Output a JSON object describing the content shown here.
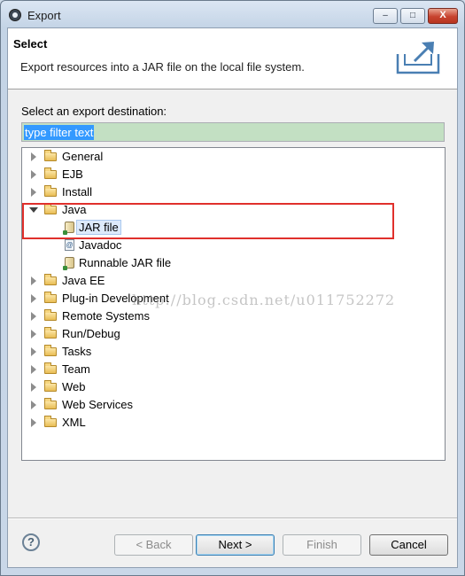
{
  "window": {
    "title": "Export",
    "controls": {
      "minimize": "‒",
      "maximize": "□",
      "close": "X"
    }
  },
  "banner": {
    "title": "Select",
    "description": "Export resources into a JAR file on the local file system.",
    "icon": "export-icon"
  },
  "destination": {
    "label": "Select an export destination:",
    "filter_value": "type filter text"
  },
  "tree": {
    "items": [
      {
        "label": "General",
        "kind": "folder",
        "expanded": false
      },
      {
        "label": "EJB",
        "kind": "folder",
        "expanded": false
      },
      {
        "label": "Install",
        "kind": "folder",
        "expanded": false
      },
      {
        "label": "Java",
        "kind": "folder",
        "expanded": true
      },
      {
        "label": "JAR file",
        "kind": "jar",
        "selected": true
      },
      {
        "label": "Javadoc",
        "kind": "doc"
      },
      {
        "label": "Runnable JAR file",
        "kind": "jar"
      },
      {
        "label": "Java EE",
        "kind": "folder",
        "expanded": false
      },
      {
        "label": "Plug-in Development",
        "kind": "folder",
        "expanded": false
      },
      {
        "label": "Remote Systems",
        "kind": "folder",
        "expanded": false
      },
      {
        "label": "Run/Debug",
        "kind": "folder",
        "expanded": false
      },
      {
        "label": "Tasks",
        "kind": "folder",
        "expanded": false
      },
      {
        "label": "Team",
        "kind": "folder",
        "expanded": false
      },
      {
        "label": "Web",
        "kind": "folder",
        "expanded": false
      },
      {
        "label": "Web Services",
        "kind": "folder",
        "expanded": false
      },
      {
        "label": "XML",
        "kind": "folder",
        "expanded": false
      }
    ],
    "javadoc_glyph": "@"
  },
  "watermark": "http://blog.csdn.net/u011752272",
  "buttons": {
    "help": "?",
    "back": "< Back",
    "next": "Next >",
    "finish": "Finish",
    "cancel": "Cancel"
  },
  "colors": {
    "filter_background": "#c3e0c3",
    "selection": "#3399ff",
    "annotation_box": "#e0302c"
  }
}
